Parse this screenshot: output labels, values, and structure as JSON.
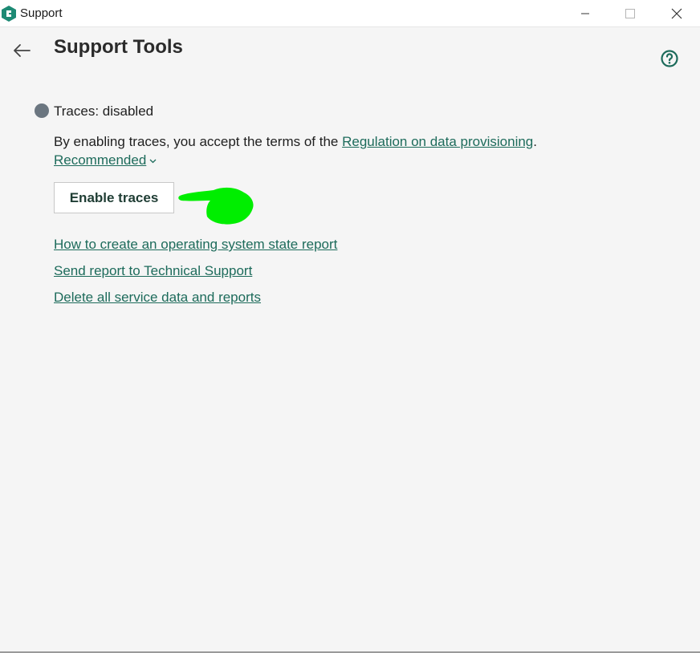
{
  "window": {
    "title": "Support",
    "controls": [
      "minimize",
      "maximize",
      "close"
    ]
  },
  "header": {
    "title": "Support Tools",
    "back_icon": "arrow-left-icon",
    "help_icon": "question-circle-icon"
  },
  "traces": {
    "status_label": "Traces: disabled",
    "terms_prefix": "By enabling traces, you accept the terms of the ",
    "terms_link": "Regulation on data provisioning",
    "terms_suffix": ".",
    "recommended_label": "Recommended",
    "enable_button": "Enable traces"
  },
  "links": [
    "How to create an operating system state report",
    "Send report to Technical Support",
    "Delete all service data and reports"
  ],
  "colors": {
    "accent": "#1d6b5b",
    "status_dot": "#6b7680",
    "annotation": "#00ee00"
  }
}
